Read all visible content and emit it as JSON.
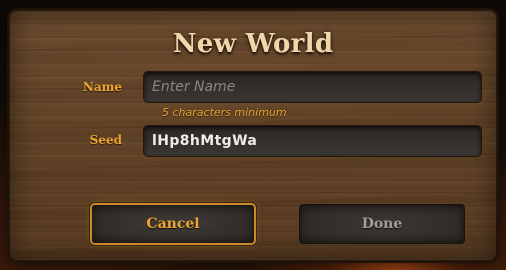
{
  "dialog": {
    "title": "New World",
    "name_field": {
      "label": "Name",
      "value": "",
      "placeholder": "Enter Name",
      "hint": "5 characters minimum"
    },
    "seed_field": {
      "label": "Seed",
      "value": "lHp8hMtgWa"
    },
    "buttons": {
      "cancel": "Cancel",
      "done": "Done"
    }
  },
  "colors": {
    "title": "#f0d6a8",
    "label_accent": "#f0a531",
    "panel_wood": "#654629",
    "field_bg": "#2f2b28",
    "done_text_disabled": "#a59f97"
  }
}
